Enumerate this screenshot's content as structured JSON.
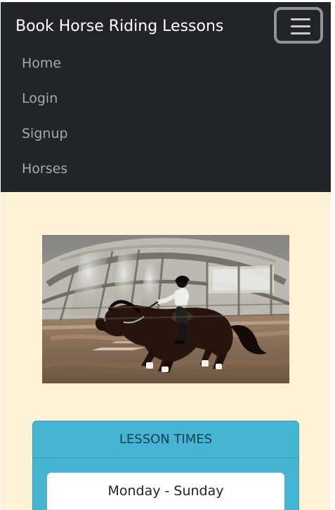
{
  "navbar": {
    "brand": "Book Horse Riding Lessons",
    "toggler_icon": "hamburger-menu-icon",
    "items": [
      {
        "label": "Home"
      },
      {
        "label": "Login"
      },
      {
        "label": "Signup"
      },
      {
        "label": "Horses"
      }
    ]
  },
  "hero": {
    "image_subject": "horse-riding-photo"
  },
  "lesson_card": {
    "title": "LESSON TIMES",
    "items": [
      {
        "label": "Monday - Sunday"
      }
    ]
  },
  "colors": {
    "navbar_background": "#212529",
    "page_background": "#fff2d6",
    "card_background": "#46b5d3",
    "brand_text": "#ffffff",
    "nav_text": "#a7aaad"
  }
}
